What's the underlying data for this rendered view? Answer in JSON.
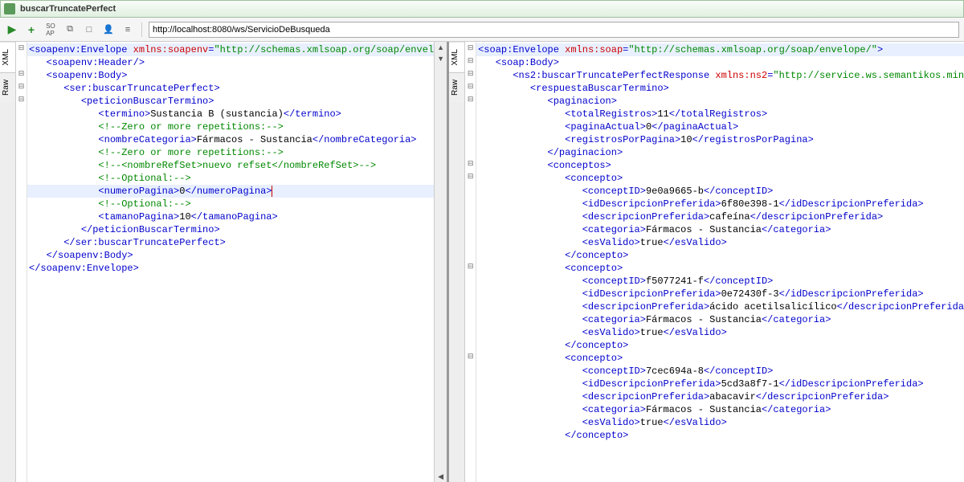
{
  "title": "buscarTruncatePerfect",
  "toolbar": {
    "url": "http://localhost:8080/ws/ServicioDeBusqueda"
  },
  "tabs": {
    "xml": "XML",
    "raw": "Raw"
  },
  "request": {
    "lines": [
      {
        "i": 0,
        "p": [
          {
            "c": "tag",
            "t": "<soapenv:Envelope "
          },
          {
            "c": "attr",
            "t": "xmlns:soapenv"
          },
          {
            "c": "tag",
            "t": "="
          },
          {
            "c": "val",
            "t": "\"http://schemas.xmlsoap.org/soap/envel"
          }
        ],
        "fold": "-",
        "hl": true
      },
      {
        "i": 1,
        "p": [
          {
            "c": "tag",
            "t": "<soapenv:Header/>"
          }
        ]
      },
      {
        "i": 1,
        "p": [
          {
            "c": "tag",
            "t": "<soapenv:Body>"
          }
        ],
        "fold": "-"
      },
      {
        "i": 2,
        "p": [
          {
            "c": "tag",
            "t": "<ser:buscarTruncatePerfect>"
          }
        ],
        "fold": "-"
      },
      {
        "i": 3,
        "p": [
          {
            "c": "tag",
            "t": "<peticionBuscarTermino>"
          }
        ],
        "fold": "-"
      },
      {
        "i": 4,
        "p": [
          {
            "c": "tag",
            "t": "<termino>"
          },
          {
            "c": "txt",
            "t": "Sustancia B (sustancia)"
          },
          {
            "c": "tag",
            "t": "</termino>"
          }
        ]
      },
      {
        "i": 4,
        "p": [
          {
            "c": "cmt",
            "t": "<!--Zero or more repetitions:-->"
          }
        ]
      },
      {
        "i": 4,
        "p": [
          {
            "c": "tag",
            "t": "<nombreCategoria>"
          },
          {
            "c": "txt",
            "t": "Fármacos - Sustancia"
          },
          {
            "c": "tag",
            "t": "</nombreCategoria>"
          }
        ]
      },
      {
        "i": 4,
        "p": [
          {
            "c": "cmt",
            "t": "<!--Zero or more repetitions:-->"
          }
        ]
      },
      {
        "i": 4,
        "p": [
          {
            "c": "cmt",
            "t": "<!--<nombreRefSet>nuevo refset</nombreRefSet>-->"
          }
        ]
      },
      {
        "i": 4,
        "p": [
          {
            "c": "cmt",
            "t": "<!--Optional:-->"
          }
        ]
      },
      {
        "i": 4,
        "p": [
          {
            "c": "tag",
            "t": "<numeroPagina>"
          },
          {
            "c": "txt",
            "t": "0"
          },
          {
            "c": "tag",
            "t": "</numeroPagina>"
          }
        ],
        "caret": true,
        "hl": true
      },
      {
        "i": 4,
        "p": [
          {
            "c": "cmt",
            "t": "<!--Optional:-->"
          }
        ]
      },
      {
        "i": 4,
        "p": [
          {
            "c": "tag",
            "t": "<tamanoPagina>"
          },
          {
            "c": "txt",
            "t": "10"
          },
          {
            "c": "tag",
            "t": "</tamanoPagina>"
          }
        ]
      },
      {
        "i": 3,
        "p": [
          {
            "c": "tag",
            "t": "</peticionBuscarTermino>"
          }
        ]
      },
      {
        "i": 2,
        "p": [
          {
            "c": "tag",
            "t": "</ser:buscarTruncatePerfect>"
          }
        ]
      },
      {
        "i": 1,
        "p": [
          {
            "c": "tag",
            "t": "</soapenv:Body>"
          }
        ]
      },
      {
        "i": 0,
        "p": [
          {
            "c": "tag",
            "t": "</soapenv:Envelope>"
          }
        ]
      }
    ]
  },
  "response": {
    "lines": [
      {
        "i": 0,
        "p": [
          {
            "c": "tag",
            "t": "<soap:Envelope "
          },
          {
            "c": "attr",
            "t": "xmlns:soap"
          },
          {
            "c": "tag",
            "t": "="
          },
          {
            "c": "val",
            "t": "\"http://schemas.xmlsoap.org/soap/envelope/\""
          },
          {
            "c": "tag",
            "t": ">"
          }
        ],
        "fold": "-",
        "hl": true
      },
      {
        "i": 1,
        "p": [
          {
            "c": "tag",
            "t": "<soap:Body>"
          }
        ],
        "fold": "-"
      },
      {
        "i": 2,
        "p": [
          {
            "c": "tag",
            "t": "<ns2:buscarTruncatePerfectResponse "
          },
          {
            "c": "attr",
            "t": "xmlns:ns2"
          },
          {
            "c": "tag",
            "t": "="
          },
          {
            "c": "val",
            "t": "\"http://service.ws.semantikos.minsa"
          }
        ],
        "fold": "-"
      },
      {
        "i": 3,
        "p": [
          {
            "c": "tag",
            "t": "<respuestaBuscarTermino>"
          }
        ],
        "fold": "-"
      },
      {
        "i": 4,
        "p": [
          {
            "c": "tag",
            "t": "<paginacion>"
          }
        ],
        "fold": "-"
      },
      {
        "i": 5,
        "p": [
          {
            "c": "tag",
            "t": "<totalRegistros>"
          },
          {
            "c": "txt",
            "t": "11"
          },
          {
            "c": "tag",
            "t": "</totalRegistros>"
          }
        ]
      },
      {
        "i": 5,
        "p": [
          {
            "c": "tag",
            "t": "<paginaActual>"
          },
          {
            "c": "txt",
            "t": "0"
          },
          {
            "c": "tag",
            "t": "</paginaActual>"
          }
        ]
      },
      {
        "i": 5,
        "p": [
          {
            "c": "tag",
            "t": "<registrosPorPagina>"
          },
          {
            "c": "txt",
            "t": "10"
          },
          {
            "c": "tag",
            "t": "</registrosPorPagina>"
          }
        ]
      },
      {
        "i": 4,
        "p": [
          {
            "c": "tag",
            "t": "</paginacion>"
          }
        ]
      },
      {
        "i": 4,
        "p": [
          {
            "c": "tag",
            "t": "<conceptos>"
          }
        ],
        "fold": "-"
      },
      {
        "i": 5,
        "p": [
          {
            "c": "tag",
            "t": "<concepto>"
          }
        ],
        "fold": "-"
      },
      {
        "i": 6,
        "p": [
          {
            "c": "tag",
            "t": "<conceptID>"
          },
          {
            "c": "txt",
            "t": "9e0a9665-b"
          },
          {
            "c": "tag",
            "t": "</conceptID>"
          }
        ]
      },
      {
        "i": 6,
        "p": [
          {
            "c": "tag",
            "t": "<idDescripcionPreferida>"
          },
          {
            "c": "txt",
            "t": "6f80e398-1"
          },
          {
            "c": "tag",
            "t": "</idDescripcionPreferida>"
          }
        ]
      },
      {
        "i": 6,
        "p": [
          {
            "c": "tag",
            "t": "<descripcionPreferida>"
          },
          {
            "c": "txt",
            "t": "cafeína"
          },
          {
            "c": "tag",
            "t": "</descripcionPreferida>"
          }
        ]
      },
      {
        "i": 6,
        "p": [
          {
            "c": "tag",
            "t": "<categoria>"
          },
          {
            "c": "txt",
            "t": "Fármacos - Sustancia"
          },
          {
            "c": "tag",
            "t": "</categoria>"
          }
        ]
      },
      {
        "i": 6,
        "p": [
          {
            "c": "tag",
            "t": "<esValido>"
          },
          {
            "c": "txt",
            "t": "true"
          },
          {
            "c": "tag",
            "t": "</esValido>"
          }
        ]
      },
      {
        "i": 5,
        "p": [
          {
            "c": "tag",
            "t": "</concepto>"
          }
        ]
      },
      {
        "i": 5,
        "p": [
          {
            "c": "tag",
            "t": "<concepto>"
          }
        ],
        "fold": "-"
      },
      {
        "i": 6,
        "p": [
          {
            "c": "tag",
            "t": "<conceptID>"
          },
          {
            "c": "txt",
            "t": "f5077241-f"
          },
          {
            "c": "tag",
            "t": "</conceptID>"
          }
        ]
      },
      {
        "i": 6,
        "p": [
          {
            "c": "tag",
            "t": "<idDescripcionPreferida>"
          },
          {
            "c": "txt",
            "t": "0e72430f-3"
          },
          {
            "c": "tag",
            "t": "</idDescripcionPreferida>"
          }
        ]
      },
      {
        "i": 6,
        "p": [
          {
            "c": "tag",
            "t": "<descripcionPreferida>"
          },
          {
            "c": "txt",
            "t": "ácido acetilsalicílico"
          },
          {
            "c": "tag",
            "t": "</descripcionPreferida>"
          }
        ]
      },
      {
        "i": 6,
        "p": [
          {
            "c": "tag",
            "t": "<categoria>"
          },
          {
            "c": "txt",
            "t": "Fármacos - Sustancia"
          },
          {
            "c": "tag",
            "t": "</categoria>"
          }
        ]
      },
      {
        "i": 6,
        "p": [
          {
            "c": "tag",
            "t": "<esValido>"
          },
          {
            "c": "txt",
            "t": "true"
          },
          {
            "c": "tag",
            "t": "</esValido>"
          }
        ]
      },
      {
        "i": 5,
        "p": [
          {
            "c": "tag",
            "t": "</concepto>"
          }
        ]
      },
      {
        "i": 5,
        "p": [
          {
            "c": "tag",
            "t": "<concepto>"
          }
        ],
        "fold": "-"
      },
      {
        "i": 6,
        "p": [
          {
            "c": "tag",
            "t": "<conceptID>"
          },
          {
            "c": "txt",
            "t": "7cec694a-8"
          },
          {
            "c": "tag",
            "t": "</conceptID>"
          }
        ]
      },
      {
        "i": 6,
        "p": [
          {
            "c": "tag",
            "t": "<idDescripcionPreferida>"
          },
          {
            "c": "txt",
            "t": "5cd3a8f7-1"
          },
          {
            "c": "tag",
            "t": "</idDescripcionPreferida>"
          }
        ]
      },
      {
        "i": 6,
        "p": [
          {
            "c": "tag",
            "t": "<descripcionPreferida>"
          },
          {
            "c": "txt",
            "t": "abacavir"
          },
          {
            "c": "tag",
            "t": "</descripcionPreferida>"
          }
        ]
      },
      {
        "i": 6,
        "p": [
          {
            "c": "tag",
            "t": "<categoria>"
          },
          {
            "c": "txt",
            "t": "Fármacos - Sustancia"
          },
          {
            "c": "tag",
            "t": "</categoria>"
          }
        ]
      },
      {
        "i": 6,
        "p": [
          {
            "c": "tag",
            "t": "<esValido>"
          },
          {
            "c": "txt",
            "t": "true"
          },
          {
            "c": "tag",
            "t": "</esValido>"
          }
        ]
      },
      {
        "i": 5,
        "p": [
          {
            "c": "tag",
            "t": "</concepto>"
          }
        ]
      }
    ]
  }
}
